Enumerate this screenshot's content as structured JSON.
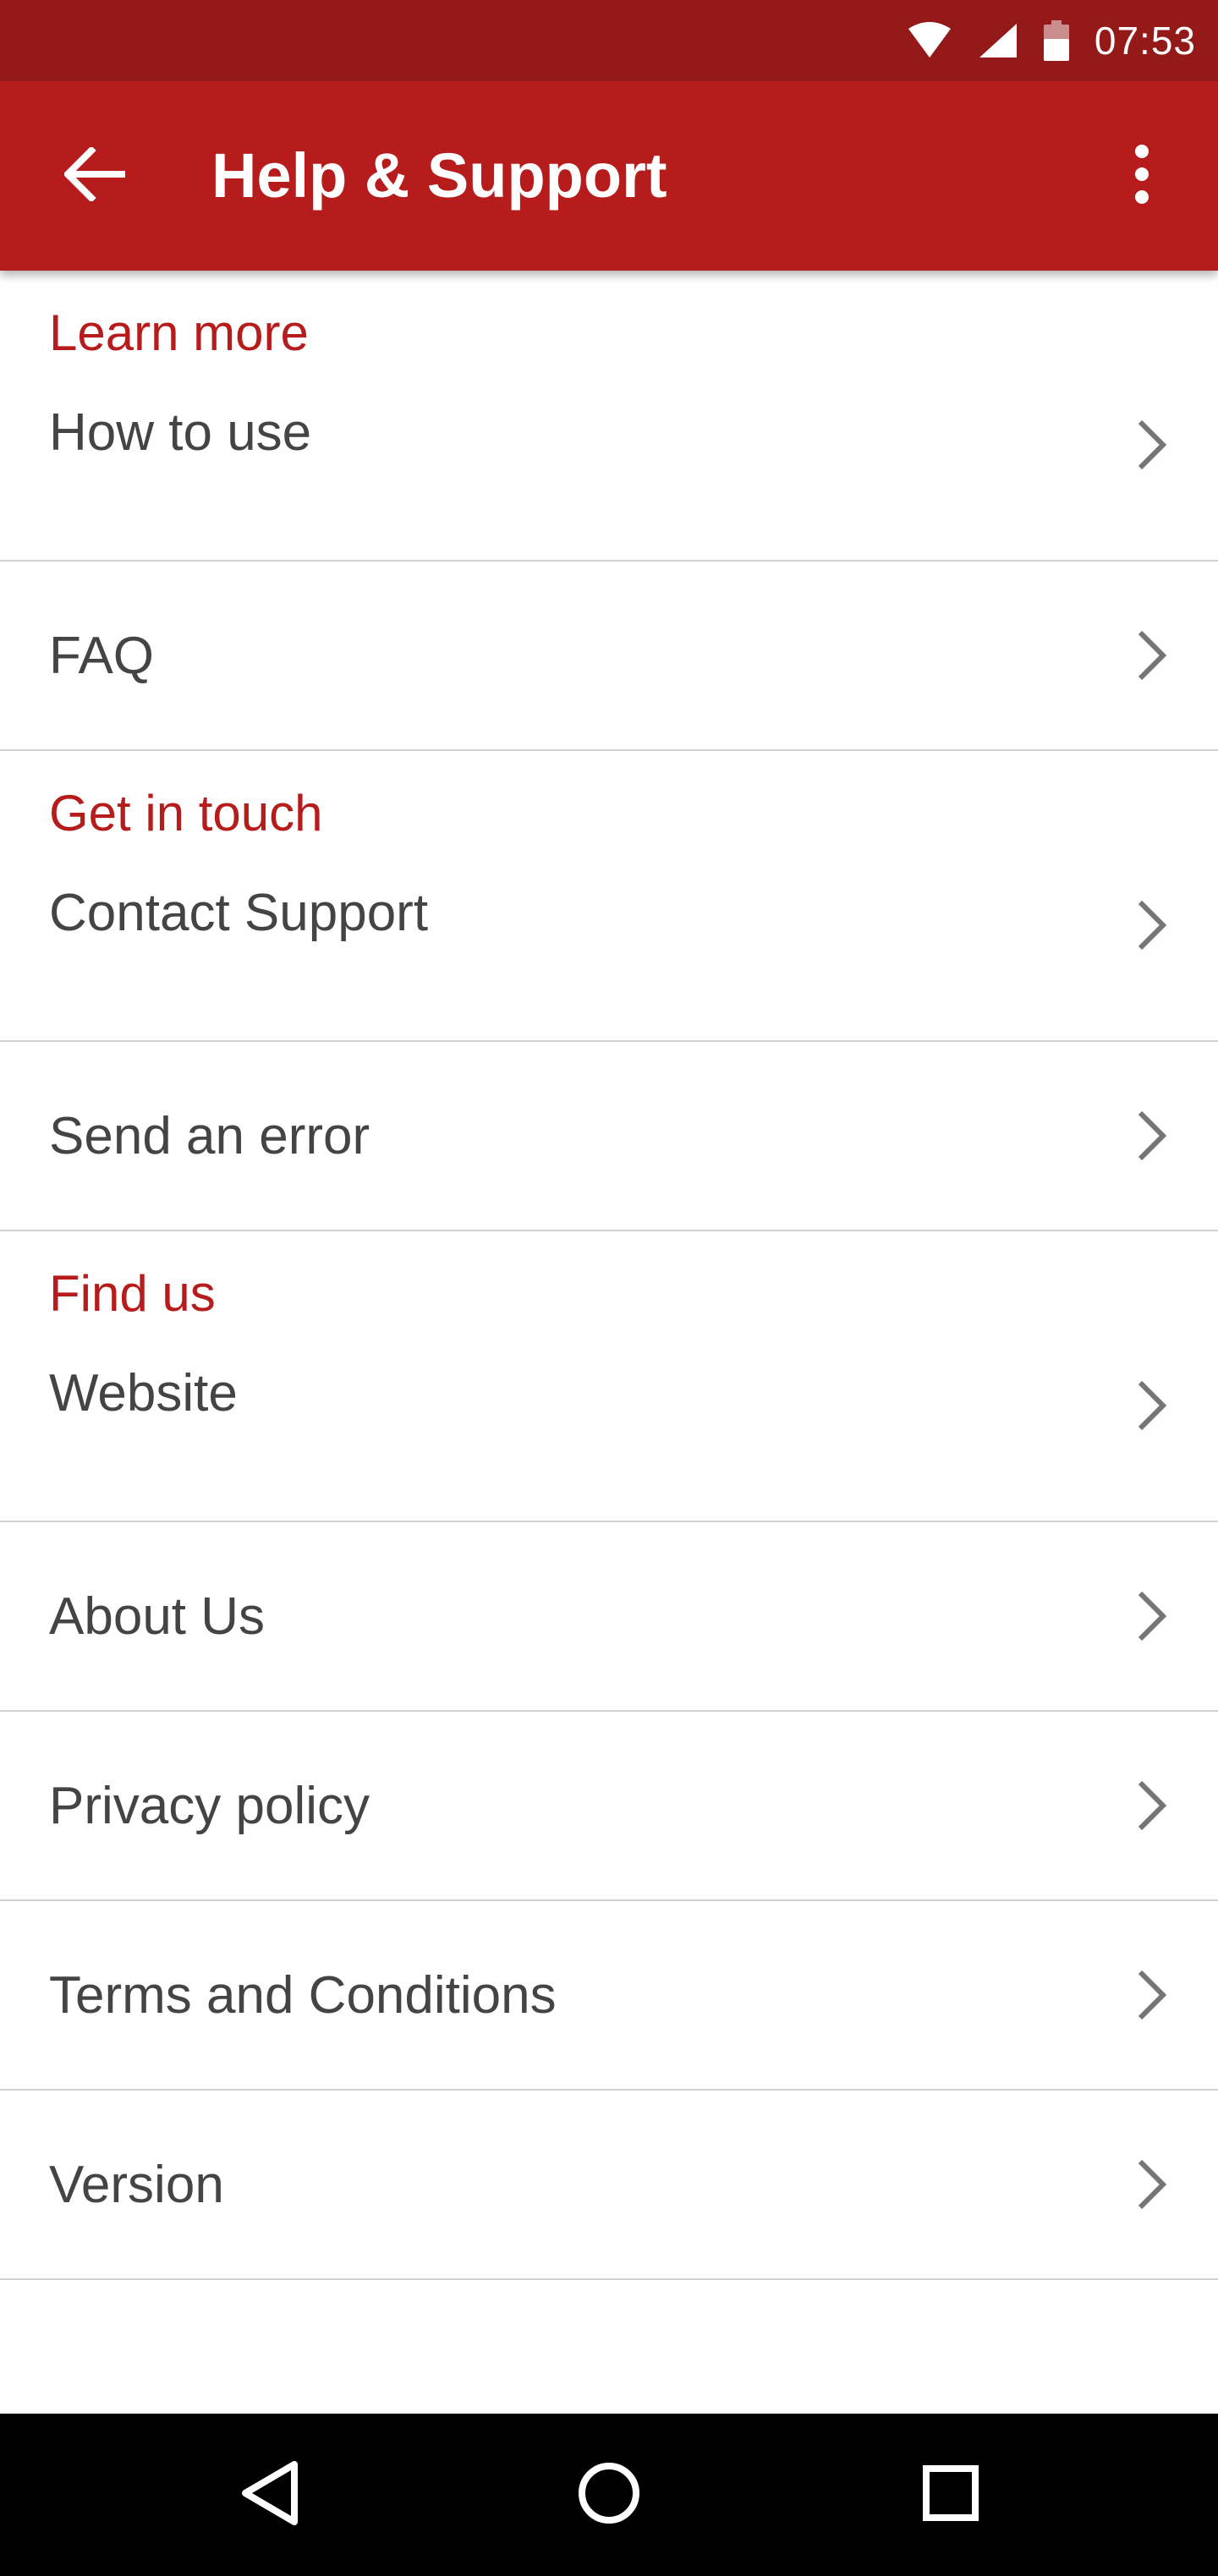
{
  "status_bar": {
    "time": "07:53",
    "icons": [
      "wifi-icon",
      "cell-signal-icon",
      "battery-icon"
    ]
  },
  "app_bar": {
    "title": "Help & Support",
    "back_icon": "arrow-back-icon",
    "menu_icon": "more-vert-icon"
  },
  "sections": {
    "learn_more": {
      "header": "Learn more",
      "items": [
        "How to use",
        "FAQ"
      ]
    },
    "get_in_touch": {
      "header": "Get in touch",
      "items": [
        "Contact Support",
        "Send an error"
      ]
    },
    "find_us": {
      "header": "Find us",
      "items": [
        "Website",
        "About Us",
        "Privacy policy",
        "Terms and Conditions",
        "Version"
      ]
    }
  },
  "nav_bar": {
    "icons": [
      "back-triangle-icon",
      "home-circle-icon",
      "recents-square-icon"
    ]
  },
  "colors": {
    "status_bar": "#941a1a",
    "app_bar": "#b71c1c",
    "accent": "#b71c1c",
    "text": "#444444",
    "divider": "#d2d2d2"
  }
}
